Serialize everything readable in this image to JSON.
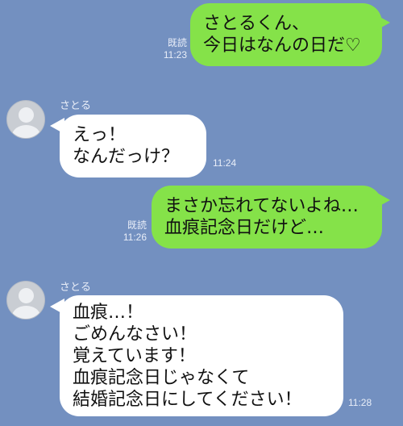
{
  "messages": [
    {
      "from": "me",
      "text": "さとるくん、\n今日はなんの日だ♡",
      "read": "既読",
      "time": "11:23"
    },
    {
      "from": "them",
      "sender": "さとる",
      "text": "えっ！\nなんだっけ？",
      "time": "11:24"
    },
    {
      "from": "me",
      "text": "まさか忘れてないよね…\n血痕記念日だけど…",
      "read": "既読",
      "time": "11:26"
    },
    {
      "from": "them",
      "sender": "さとる",
      "text": "血痕…！\nごめんなさい！\n覚えています！\n血痕記念日じゃなくて\n結婚記念日にしてください！",
      "time": "11:28"
    }
  ],
  "colors": {
    "background": "#7390c0",
    "outgoing_bubble": "#85e249",
    "incoming_bubble": "#ffffff"
  },
  "icons": {
    "avatar": "default-user-avatar-icon"
  }
}
